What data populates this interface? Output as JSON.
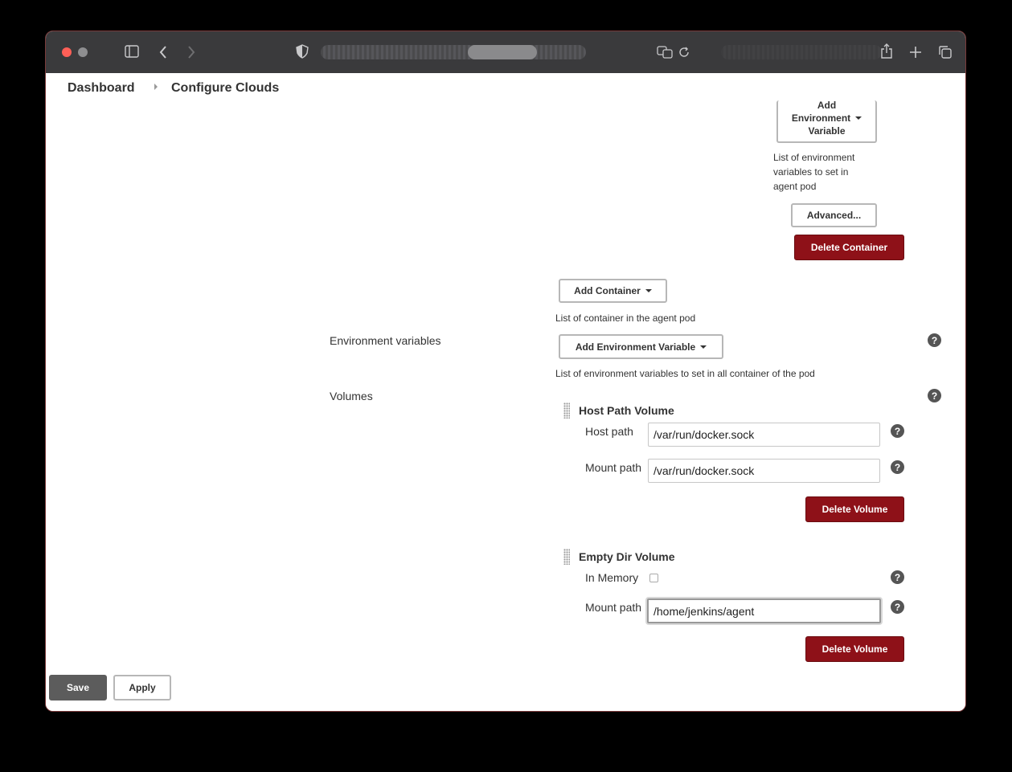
{
  "browser": {
    "icons": [
      "sidebar-icon",
      "back-icon",
      "forward-icon",
      "shield-icon",
      "translate-icon",
      "reload-icon",
      "share-icon",
      "new-tab-icon",
      "tabs-overview-icon"
    ]
  },
  "breadcrumb": {
    "items": [
      "Dashboard",
      "Configure Clouds"
    ]
  },
  "container": {
    "add_env_var_label_line1": "Add",
    "add_env_var_label_line2": "Environment",
    "add_env_var_label_line3": "Variable",
    "env_var_desc": "List of environment variables to set in agent pod",
    "advanced_label": "Advanced...",
    "delete_container_label": "Delete Container"
  },
  "containers": {
    "add_container_label": "Add Container",
    "desc": "List of container in the agent pod"
  },
  "env_vars": {
    "label": "Environment variables",
    "add_label": "Add Environment Variable",
    "desc": "List of environment variables to set in all container of the pod"
  },
  "volumes": {
    "label": "Volumes",
    "host_path": {
      "title": "Host Path Volume",
      "host_path_label": "Host path",
      "host_path_value": "/var/run/docker.sock",
      "mount_path_label": "Mount path",
      "mount_path_value": "/var/run/docker.sock",
      "delete_label": "Delete Volume"
    },
    "empty_dir": {
      "title": "Empty Dir Volume",
      "in_memory_label": "In Memory",
      "in_memory_checked": false,
      "mount_path_label": "Mount path",
      "mount_path_value": "/home/jenkins/agent",
      "delete_label": "Delete Volume"
    }
  },
  "help_icon_text": "?",
  "footer": {
    "save_label": "Save",
    "apply_label": "Apply"
  },
  "colors": {
    "danger": "#8e1118",
    "primary_btn": "#5c5c5c",
    "toolbar": "#3a3a3c"
  }
}
